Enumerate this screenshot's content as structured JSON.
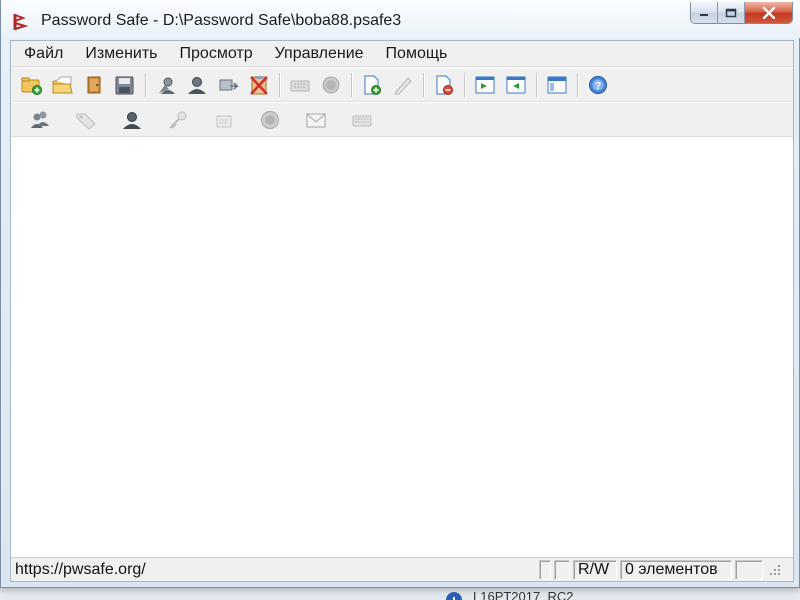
{
  "window": {
    "title": "Password Safe - D:\\Password Safe\\boba88.psafe3"
  },
  "menu": [
    {
      "id": "file",
      "label": "Файл"
    },
    {
      "id": "edit",
      "label": "Изменить"
    },
    {
      "id": "view",
      "label": "Просмотр"
    },
    {
      "id": "manage",
      "label": "Управление"
    },
    {
      "id": "help",
      "label": "Помощь"
    }
  ],
  "toolbar_main": [
    {
      "icon": "new-database-icon",
      "enabled": true
    },
    {
      "icon": "open-database-icon",
      "enabled": true
    },
    {
      "icon": "close-database-icon",
      "enabled": true
    },
    {
      "icon": "save-icon",
      "enabled": true
    },
    {
      "icon": "copy-user-icon",
      "enabled": true
    },
    {
      "icon": "copy-password-icon",
      "enabled": true
    },
    {
      "icon": "copy-notes-icon",
      "enabled": true
    },
    {
      "icon": "clear-clipboard-icon",
      "enabled": true
    },
    {
      "icon": "autotype-icon",
      "enabled": false
    },
    {
      "icon": "browse-url-icon",
      "enabled": false
    },
    {
      "icon": "add-entry-icon",
      "enabled": true
    },
    {
      "icon": "edit-entry-icon",
      "enabled": false
    },
    {
      "icon": "delete-entry-icon",
      "enabled": true
    },
    {
      "icon": "expand-all-icon",
      "enabled": true
    },
    {
      "icon": "collapse-all-icon",
      "enabled": true
    },
    {
      "icon": "options-icon",
      "enabled": true
    },
    {
      "icon": "help-icon",
      "enabled": true
    }
  ],
  "toolbar_secondary": [
    {
      "icon": "copy-username-icon",
      "enabled": true
    },
    {
      "icon": "tag-icon",
      "enabled": false
    },
    {
      "icon": "user-icon",
      "enabled": true
    },
    {
      "icon": "key-icon",
      "enabled": false
    },
    {
      "icon": "notes-icon",
      "enabled": false
    },
    {
      "icon": "globe-icon",
      "enabled": false
    },
    {
      "icon": "email-icon",
      "enabled": false
    },
    {
      "icon": "keyboard-icon",
      "enabled": false
    }
  ],
  "status": {
    "url": "https://pwsafe.org/",
    "mode": "R/W",
    "count": "0 элементов"
  },
  "taskbar_peek": {
    "text": "L16PT2017_RC2"
  },
  "colors": {
    "accent": "#3a78c8",
    "close_red": "#c23a20",
    "toolbar_bg": "#f0f0f0"
  }
}
